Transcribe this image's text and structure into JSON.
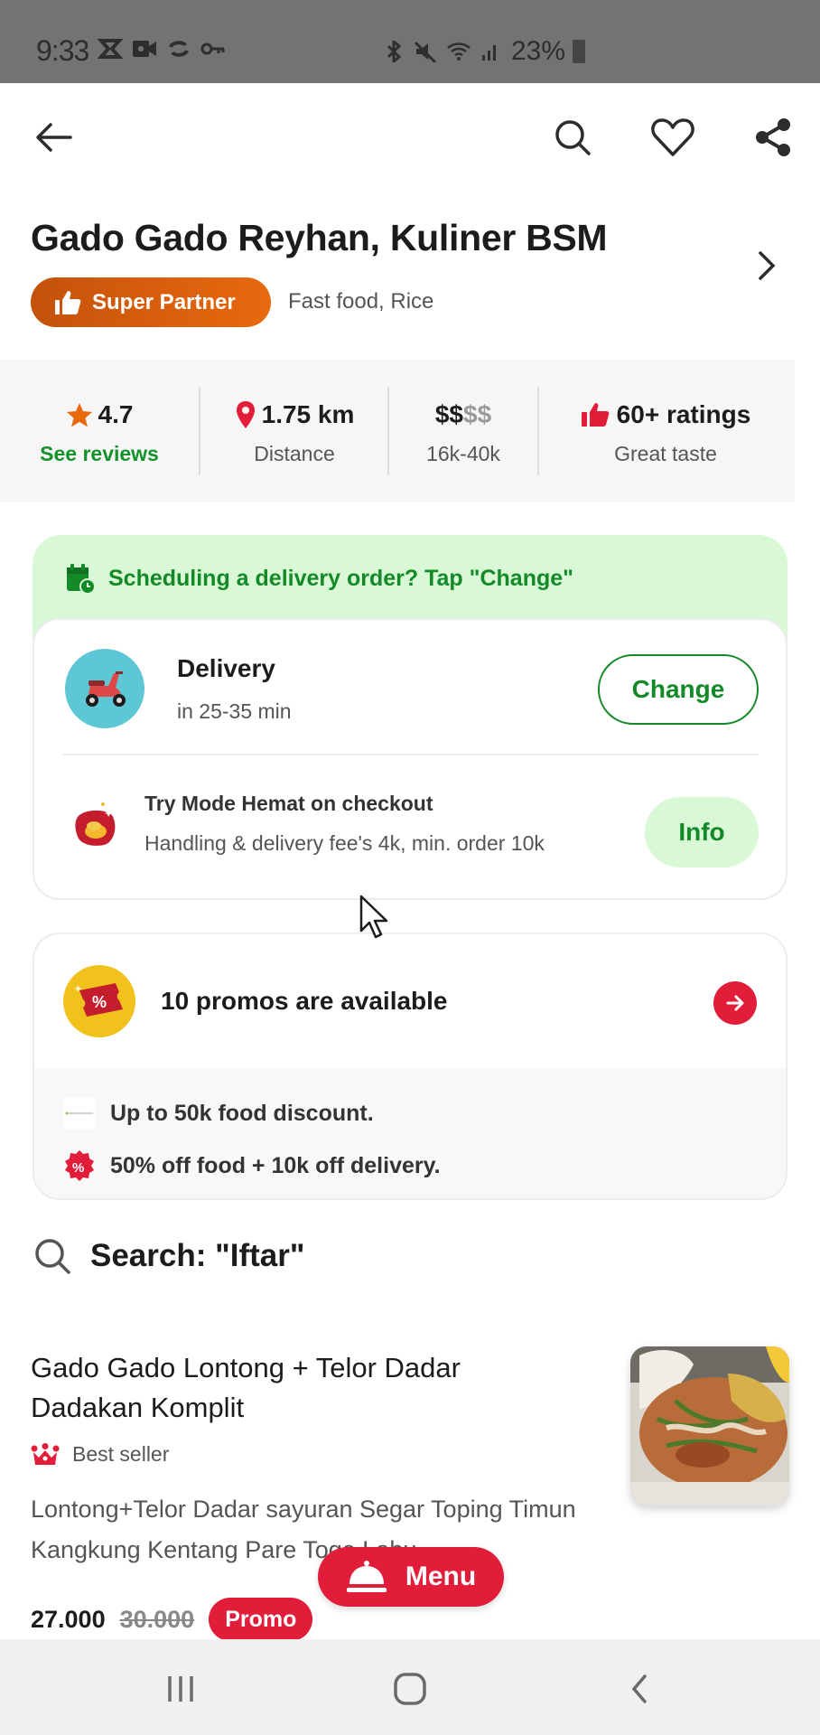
{
  "status_bar": {
    "time": "9:33",
    "left_icons": [
      "capcut-icon",
      "video-icon",
      "sync-icon",
      "key-icon"
    ],
    "right_icons": [
      "bluetooth-icon",
      "mute-icon",
      "wifi-icon",
      "signal-icon"
    ],
    "battery": "23%"
  },
  "topnav": {
    "icons": [
      "back-arrow-icon",
      "search-icon",
      "heart-icon",
      "share-icon"
    ]
  },
  "restaurant": {
    "name": "Gado Gado Reyhan, Kuliner BSM",
    "badge": "Super Partner",
    "cuisine": "Fast food, Rice"
  },
  "stats": [
    {
      "value": "4.7",
      "label": "See reviews",
      "icon": "star-icon"
    },
    {
      "value": "1.75 km",
      "label": "Distance",
      "icon": "location-pin-icon"
    },
    {
      "value_active": "$$",
      "value_inactive": "$$",
      "label": "16k-40k"
    },
    {
      "value": "60+ ratings",
      "label": "Great taste",
      "icon": "thumbs-up-icon"
    }
  ],
  "delivery": {
    "schedule_banner": "Scheduling a delivery order? Tap \"Change\"",
    "title": "Delivery",
    "eta": "in 25-35 min",
    "change_label": "Change",
    "hemat_title": "Try Mode Hemat on checkout",
    "hemat_sub": "Handling & delivery fee's 4k, min. order 10k",
    "info_label": "Info"
  },
  "promos": {
    "title": "10 promos are available",
    "items": [
      "Up to 50k food discount.",
      "50% off food + 10k off delivery."
    ]
  },
  "search": {
    "heading": "Search: \"Iftar\""
  },
  "menu_item": {
    "name": "Gado Gado Lontong + Telor Dadar Dadakan Komplit",
    "badge": "Best seller",
    "description": "Lontong+Telor Dadar sayuran Segar Toping Timun Kangkung Kentang Pare Toge Labu ...",
    "price": "27.000",
    "original_price": "30.000",
    "promo_label": "Promo"
  },
  "fab": {
    "label": "Menu"
  },
  "colors": {
    "primary_green": "#138a27",
    "light_green": "#d9f8d6",
    "brand_red": "#e11d3a",
    "super_partner_orange": "#e8690e"
  }
}
